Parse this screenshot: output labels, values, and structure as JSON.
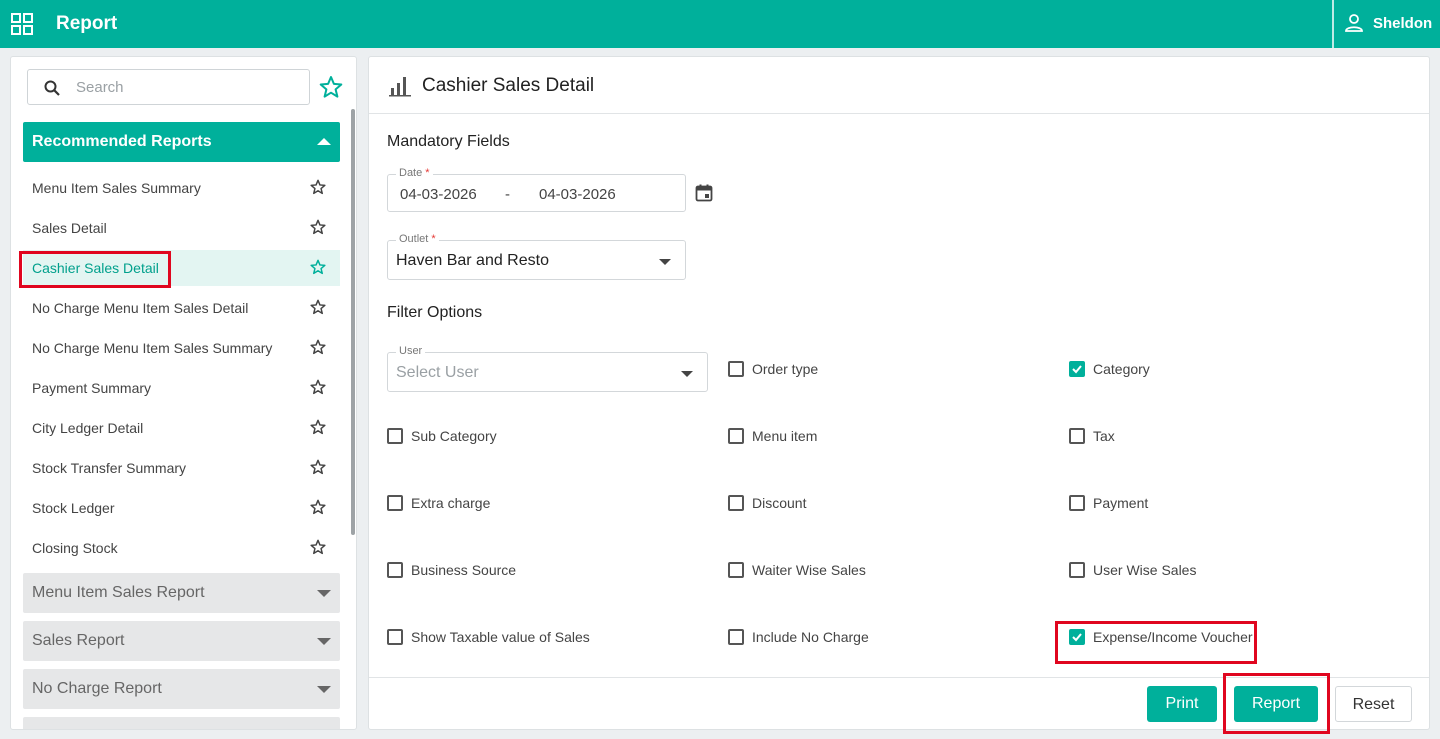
{
  "app": {
    "title": "Report",
    "user": "Sheldon"
  },
  "sidebar": {
    "search_placeholder": "Search",
    "recommended_title": "Recommended Reports",
    "items": [
      {
        "label": "Menu Item Sales Summary"
      },
      {
        "label": "Sales Detail"
      },
      {
        "label": "Cashier Sales Detail",
        "active": true
      },
      {
        "label": "No Charge Menu Item Sales Detail"
      },
      {
        "label": "No Charge Menu Item Sales Summary"
      },
      {
        "label": "Payment Summary"
      },
      {
        "label": "City Ledger Detail"
      },
      {
        "label": "Stock Transfer Summary"
      },
      {
        "label": "Stock Ledger"
      },
      {
        "label": "Closing Stock"
      }
    ],
    "sections": [
      {
        "label": "Menu Item Sales Report"
      },
      {
        "label": "Sales Report"
      },
      {
        "label": "No Charge Report"
      }
    ]
  },
  "main": {
    "title": "Cashier Sales Detail",
    "mandatory_title": "Mandatory Fields",
    "date_label": "Date",
    "date_required": "*",
    "date_from": "04-03-2026",
    "date_sep": "-",
    "date_to": "04-03-2026",
    "outlet_label": "Outlet",
    "outlet_required": "*",
    "outlet_value": "Haven Bar and Resto",
    "filter_title": "Filter Options",
    "user_label": "User",
    "user_placeholder": "Select User",
    "options": [
      {
        "label": "Order type",
        "checked": false
      },
      {
        "label": "Category",
        "checked": true
      },
      {
        "label": "Sub Category",
        "checked": false
      },
      {
        "label": "Menu item",
        "checked": false
      },
      {
        "label": "Tax",
        "checked": false
      },
      {
        "label": "Extra charge",
        "checked": false
      },
      {
        "label": "Discount",
        "checked": false
      },
      {
        "label": "Payment",
        "checked": false
      },
      {
        "label": "Business Source",
        "checked": false
      },
      {
        "label": "Waiter Wise Sales",
        "checked": false
      },
      {
        "label": "User Wise Sales",
        "checked": false
      },
      {
        "label": "Show Taxable value of Sales",
        "checked": false
      },
      {
        "label": "Include No Charge",
        "checked": false
      },
      {
        "label": "Expense/Income Voucher",
        "checked": true
      }
    ],
    "buttons": {
      "print": "Print",
      "report": "Report",
      "reset": "Reset"
    }
  },
  "colors": {
    "accent": "#00b09b",
    "highlight": "#e0061f"
  },
  "icons": {
    "apps": "apps-grid-icon",
    "user": "person-icon",
    "search": "search-icon",
    "star": "star-outline-icon",
    "chart": "bar-chart-icon",
    "calendar": "calendar-icon"
  }
}
